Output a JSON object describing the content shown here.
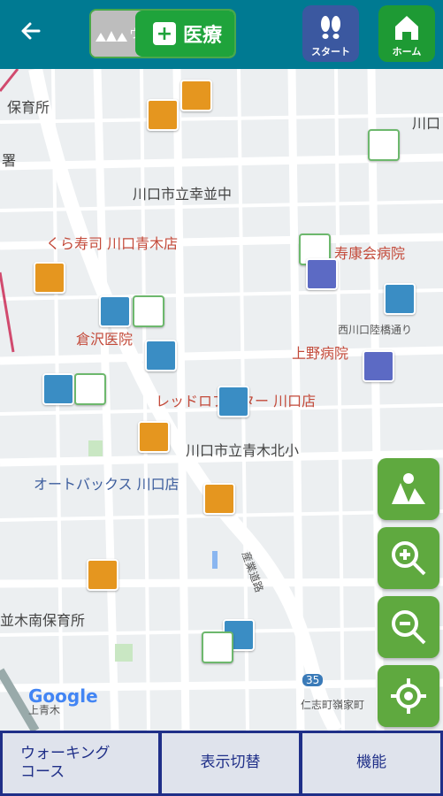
{
  "header": {
    "toggle_left_label": "ウ",
    "toggle_right_label": "医療",
    "start_label": "スタート",
    "home_label": "ホーム"
  },
  "map": {
    "labels": {
      "hoikuen_top": "保育所",
      "sho": "署",
      "saiwai": "川口市立幸並中",
      "kura": "くら寿司 川口青木店",
      "jukokai": "寿康会病院",
      "kurasawa": "倉沢医院",
      "nishikawaguchi": "西川口陸橋通り",
      "ueno": "上野病院",
      "red_lobster": "レッドロブスター 川口店",
      "aoki_kita": "川口市立青木北小",
      "autobacs": "オートバックス 川口店",
      "sangyo": "産業道路",
      "namiki": "並木南保育所",
      "route": "35",
      "kawaguchi_top": "川口",
      "jinshi": "仁志町嶺家町",
      "kamiaoki": "上青木",
      "google": "Google"
    }
  },
  "bottom_nav": {
    "walking": "ウォーキング\nコース",
    "display_switch": "表示切替",
    "function": "機能"
  },
  "colors": {
    "header": "#007a92",
    "medical_green": "#1fa33b",
    "start_blue": "#3b58a0",
    "side_green": "#5fa93f",
    "bottom_navy": "#1f2f88"
  }
}
